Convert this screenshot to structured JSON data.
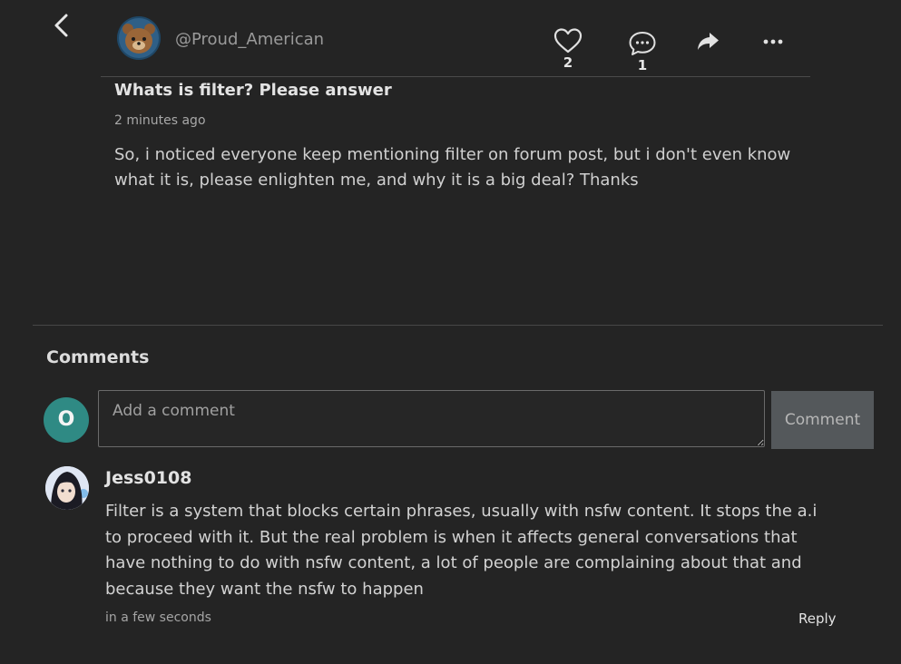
{
  "post": {
    "author": "@Proud_American",
    "title": "Whats is filter? Please answer",
    "time": "2 minutes ago",
    "body": "So, i noticed everyone keep mentioning filter on forum post, but i don't even know what it is, please enlighten me, and why it is a big deal? Thanks",
    "like_count": "2",
    "comment_count": "1"
  },
  "comments_section": {
    "heading": "Comments",
    "current_user_initial": "O",
    "input_placeholder": "Add a comment",
    "input_value": "",
    "submit_label": "Comment"
  },
  "comments": [
    {
      "user": "Jess0108",
      "body": "Filter is a system that blocks certain phrases, usually with nsfw content. It stops the a.i to proceed with it. But the real problem is when it affects general conversations that have nothing to do with nsfw content, a lot of people are complaining about that and because they want the nsfw to happen",
      "time": "in a few seconds",
      "reply_label": "Reply"
    }
  ],
  "icons": {
    "back": "chevron-left-icon",
    "like": "heart-icon",
    "comment": "speech-bubble-icon",
    "share": "share-arrow-icon",
    "more": "ellipsis-icon"
  },
  "colors": {
    "background": "#242424",
    "avatar_initial_bg": "#2f8a84",
    "comment_button_bg": "#54585b"
  }
}
